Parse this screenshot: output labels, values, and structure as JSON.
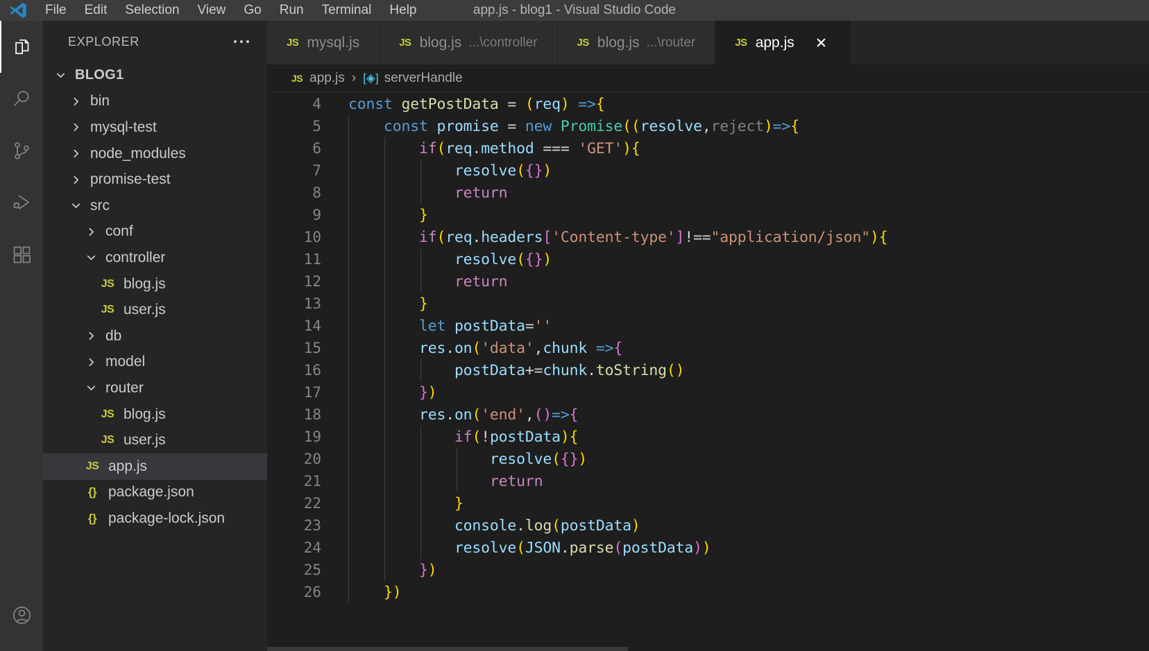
{
  "window": {
    "title": "app.js - blog1 - Visual Studio Code",
    "logo_icon": "vscode-logo-icon"
  },
  "menubar": {
    "items": [
      {
        "label": "File"
      },
      {
        "label": "Edit"
      },
      {
        "label": "Selection"
      },
      {
        "label": "View"
      },
      {
        "label": "Go"
      },
      {
        "label": "Run"
      },
      {
        "label": "Terminal"
      },
      {
        "label": "Help"
      }
    ]
  },
  "activitybar": {
    "items": [
      {
        "name": "explorer",
        "icon": "files-icon",
        "active": true
      },
      {
        "name": "search",
        "icon": "search-icon",
        "active": false
      },
      {
        "name": "source-control",
        "icon": "source-control-icon",
        "active": false
      },
      {
        "name": "run-and-debug",
        "icon": "run-debug-icon",
        "active": false
      },
      {
        "name": "extensions",
        "icon": "extensions-icon",
        "active": false
      }
    ],
    "bottom": [
      {
        "name": "accounts",
        "icon": "account-icon"
      }
    ]
  },
  "sidebar": {
    "title": "EXPLORER",
    "more_icon": "ellipsis-icon",
    "tree": [
      {
        "label": "BLOG1",
        "depth": 0,
        "type": "root",
        "state": "expanded",
        "selected": false
      },
      {
        "label": "bin",
        "depth": 1,
        "type": "folder",
        "state": "collapsed",
        "selected": false
      },
      {
        "label": "mysql-test",
        "depth": 1,
        "type": "folder",
        "state": "collapsed",
        "selected": false
      },
      {
        "label": "node_modules",
        "depth": 1,
        "type": "folder",
        "state": "collapsed",
        "selected": false
      },
      {
        "label": "promise-test",
        "depth": 1,
        "type": "folder",
        "state": "collapsed",
        "selected": false
      },
      {
        "label": "src",
        "depth": 1,
        "type": "folder",
        "state": "expanded",
        "selected": false
      },
      {
        "label": "conf",
        "depth": 2,
        "type": "folder",
        "state": "collapsed",
        "selected": false
      },
      {
        "label": "controller",
        "depth": 2,
        "type": "folder",
        "state": "expanded",
        "selected": false
      },
      {
        "label": "blog.js",
        "depth": 3,
        "type": "js",
        "state": "",
        "selected": false
      },
      {
        "label": "user.js",
        "depth": 3,
        "type": "js",
        "state": "",
        "selected": false
      },
      {
        "label": "db",
        "depth": 2,
        "type": "folder",
        "state": "collapsed",
        "selected": false
      },
      {
        "label": "model",
        "depth": 2,
        "type": "folder",
        "state": "collapsed",
        "selected": false
      },
      {
        "label": "router",
        "depth": 2,
        "type": "folder",
        "state": "expanded",
        "selected": false
      },
      {
        "label": "blog.js",
        "depth": 3,
        "type": "js",
        "state": "",
        "selected": false
      },
      {
        "label": "user.js",
        "depth": 3,
        "type": "js",
        "state": "",
        "selected": false
      },
      {
        "label": "app.js",
        "depth": 2,
        "type": "js",
        "state": "",
        "selected": true
      },
      {
        "label": "package.json",
        "depth": 2,
        "type": "json",
        "state": "",
        "selected": false
      },
      {
        "label": "package-lock.json",
        "depth": 2,
        "type": "json",
        "state": "",
        "selected": false
      }
    ]
  },
  "editor": {
    "tabs": [
      {
        "icon": "js-file-icon",
        "label": "mysql.js",
        "path": "",
        "active": false,
        "closeable": false
      },
      {
        "icon": "js-file-icon",
        "label": "blog.js",
        "path": "...\\controller",
        "active": false,
        "closeable": false
      },
      {
        "icon": "js-file-icon",
        "label": "blog.js",
        "path": "...\\router",
        "active": false,
        "closeable": false
      },
      {
        "icon": "js-file-icon",
        "label": "app.js",
        "path": "",
        "active": true,
        "closeable": true
      }
    ],
    "close_icon": "close-icon",
    "breadcrumb": {
      "file_icon": "js-file-icon",
      "file": "app.js",
      "separator": "›",
      "symbol_icon": "symbol-variable-icon",
      "symbol": "serverHandle"
    },
    "lines": [
      {
        "n": 4,
        "indent": 0,
        "tokens": [
          {
            "t": "const ",
            "c": "k"
          },
          {
            "t": "getPostData",
            "c": "fn"
          },
          {
            "t": " = ",
            "c": "op"
          },
          {
            "t": "(",
            "c": "p1"
          },
          {
            "t": "req",
            "c": "pm"
          },
          {
            "t": ")",
            "c": "p1"
          },
          {
            "t": " ",
            "c": "op"
          },
          {
            "t": "=>",
            "c": "k"
          },
          {
            "t": "{",
            "c": "p1"
          }
        ]
      },
      {
        "n": 5,
        "indent": 1,
        "tokens": [
          {
            "t": "const ",
            "c": "k"
          },
          {
            "t": "promise",
            "c": "va"
          },
          {
            "t": " = ",
            "c": "op"
          },
          {
            "t": "new ",
            "c": "k"
          },
          {
            "t": "Promise",
            "c": "cls"
          },
          {
            "t": "((",
            "c": "p1"
          },
          {
            "t": "resolve",
            "c": "pm"
          },
          {
            "t": ",",
            "c": "op"
          },
          {
            "t": "reject",
            "c": "pmd"
          },
          {
            "t": ")",
            "c": "p1"
          },
          {
            "t": "=>",
            "c": "k"
          },
          {
            "t": "{",
            "c": "p1"
          }
        ]
      },
      {
        "n": 6,
        "indent": 2,
        "tokens": [
          {
            "t": "if",
            "c": "kc"
          },
          {
            "t": "(",
            "c": "p1"
          },
          {
            "t": "req",
            "c": "va"
          },
          {
            "t": ".",
            "c": "op"
          },
          {
            "t": "method",
            "c": "va"
          },
          {
            "t": " === ",
            "c": "op"
          },
          {
            "t": "'GET'",
            "c": "str"
          },
          {
            "t": ")",
            "c": "p1"
          },
          {
            "t": "{",
            "c": "p1"
          }
        ]
      },
      {
        "n": 7,
        "indent": 3,
        "tokens": [
          {
            "t": "resolve",
            "c": "va"
          },
          {
            "t": "(",
            "c": "p1"
          },
          {
            "t": "{",
            "c": "p2"
          },
          {
            "t": "}",
            "c": "p2"
          },
          {
            "t": ")",
            "c": "p1"
          }
        ]
      },
      {
        "n": 8,
        "indent": 3,
        "tokens": [
          {
            "t": "return",
            "c": "kc"
          }
        ]
      },
      {
        "n": 9,
        "indent": 2,
        "tokens": [
          {
            "t": "}",
            "c": "p1"
          }
        ]
      },
      {
        "n": 10,
        "indent": 2,
        "tokens": [
          {
            "t": "if",
            "c": "kc"
          },
          {
            "t": "(",
            "c": "p1"
          },
          {
            "t": "req",
            "c": "va"
          },
          {
            "t": ".",
            "c": "op"
          },
          {
            "t": "headers",
            "c": "va"
          },
          {
            "t": "[",
            "c": "p2"
          },
          {
            "t": "'Content-type'",
            "c": "str"
          },
          {
            "t": "]",
            "c": "p2"
          },
          {
            "t": "!==",
            "c": "op"
          },
          {
            "t": "\"application/json\"",
            "c": "str"
          },
          {
            "t": ")",
            "c": "p1"
          },
          {
            "t": "{",
            "c": "p1"
          }
        ]
      },
      {
        "n": 11,
        "indent": 3,
        "tokens": [
          {
            "t": "resolve",
            "c": "va"
          },
          {
            "t": "(",
            "c": "p1"
          },
          {
            "t": "{",
            "c": "p2"
          },
          {
            "t": "}",
            "c": "p2"
          },
          {
            "t": ")",
            "c": "p1"
          }
        ]
      },
      {
        "n": 12,
        "indent": 3,
        "tokens": [
          {
            "t": "return",
            "c": "kc"
          }
        ]
      },
      {
        "n": 13,
        "indent": 2,
        "tokens": [
          {
            "t": "}",
            "c": "p1"
          }
        ]
      },
      {
        "n": 14,
        "indent": 2,
        "tokens": [
          {
            "t": "let ",
            "c": "k"
          },
          {
            "t": "postData",
            "c": "va"
          },
          {
            "t": "=",
            "c": "op"
          },
          {
            "t": "''",
            "c": "str"
          }
        ]
      },
      {
        "n": 15,
        "indent": 2,
        "tokens": [
          {
            "t": "res",
            "c": "va"
          },
          {
            "t": ".",
            "c": "op"
          },
          {
            "t": "on",
            "c": "va"
          },
          {
            "t": "(",
            "c": "p1"
          },
          {
            "t": "'data'",
            "c": "str"
          },
          {
            "t": ",",
            "c": "op"
          },
          {
            "t": "chunk",
            "c": "pm"
          },
          {
            "t": " ",
            "c": "op"
          },
          {
            "t": "=>",
            "c": "k"
          },
          {
            "t": "{",
            "c": "p2"
          }
        ]
      },
      {
        "n": 16,
        "indent": 3,
        "tokens": [
          {
            "t": "postData",
            "c": "va"
          },
          {
            "t": "+=",
            "c": "op"
          },
          {
            "t": "chunk",
            "c": "va"
          },
          {
            "t": ".",
            "c": "op"
          },
          {
            "t": "toString",
            "c": "fn"
          },
          {
            "t": "()",
            "c": "p1"
          }
        ]
      },
      {
        "n": 17,
        "indent": 2,
        "tokens": [
          {
            "t": "}",
            "c": "p2"
          },
          {
            "t": ")",
            "c": "p1"
          }
        ]
      },
      {
        "n": 18,
        "indent": 2,
        "tokens": [
          {
            "t": "res",
            "c": "va"
          },
          {
            "t": ".",
            "c": "op"
          },
          {
            "t": "on",
            "c": "va"
          },
          {
            "t": "(",
            "c": "p1"
          },
          {
            "t": "'end'",
            "c": "str"
          },
          {
            "t": ",",
            "c": "op"
          },
          {
            "t": "()",
            "c": "p2"
          },
          {
            "t": "=>",
            "c": "k"
          },
          {
            "t": "{",
            "c": "p2"
          }
        ]
      },
      {
        "n": 19,
        "indent": 3,
        "tokens": [
          {
            "t": "if",
            "c": "kc"
          },
          {
            "t": "(",
            "c": "p1"
          },
          {
            "t": "!",
            "c": "op"
          },
          {
            "t": "postData",
            "c": "va"
          },
          {
            "t": ")",
            "c": "p1"
          },
          {
            "t": "{",
            "c": "p1"
          }
        ]
      },
      {
        "n": 20,
        "indent": 4,
        "tokens": [
          {
            "t": "resolve",
            "c": "va"
          },
          {
            "t": "(",
            "c": "p1"
          },
          {
            "t": "{",
            "c": "p2"
          },
          {
            "t": "}",
            "c": "p2"
          },
          {
            "t": ")",
            "c": "p1"
          }
        ]
      },
      {
        "n": 21,
        "indent": 4,
        "tokens": [
          {
            "t": "return",
            "c": "kc"
          }
        ]
      },
      {
        "n": 22,
        "indent": 3,
        "tokens": [
          {
            "t": "}",
            "c": "p1"
          }
        ]
      },
      {
        "n": 23,
        "indent": 3,
        "tokens": [
          {
            "t": "console",
            "c": "va"
          },
          {
            "t": ".",
            "c": "op"
          },
          {
            "t": "log",
            "c": "fn"
          },
          {
            "t": "(",
            "c": "p1"
          },
          {
            "t": "postData",
            "c": "va"
          },
          {
            "t": ")",
            "c": "p1"
          }
        ]
      },
      {
        "n": 24,
        "indent": 3,
        "tokens": [
          {
            "t": "resolve",
            "c": "va"
          },
          {
            "t": "(",
            "c": "p1"
          },
          {
            "t": "JSON",
            "c": "va"
          },
          {
            "t": ".",
            "c": "op"
          },
          {
            "t": "parse",
            "c": "fn"
          },
          {
            "t": "(",
            "c": "p2"
          },
          {
            "t": "postData",
            "c": "va"
          },
          {
            "t": ")",
            "c": "p2"
          },
          {
            "t": ")",
            "c": "p1"
          }
        ]
      },
      {
        "n": 25,
        "indent": 2,
        "tokens": [
          {
            "t": "}",
            "c": "p2"
          },
          {
            "t": ")",
            "c": "p1"
          }
        ]
      },
      {
        "n": 26,
        "indent": 1,
        "tokens": [
          {
            "t": "}",
            "c": "p1"
          },
          {
            "t": ")",
            "c": "p1"
          }
        ]
      }
    ]
  },
  "colors": {
    "titlebar_bg": "#3c3c3c",
    "activitybar_bg": "#333333",
    "sidebar_bg": "#252526",
    "editor_bg": "#1e1e1e",
    "tab_inactive_bg": "#2d2d2d",
    "tab_active_bg": "#1e1e1e",
    "selection_bg": "#37373d",
    "js_icon": "#cbcb41",
    "accent": "#ffffff"
  }
}
